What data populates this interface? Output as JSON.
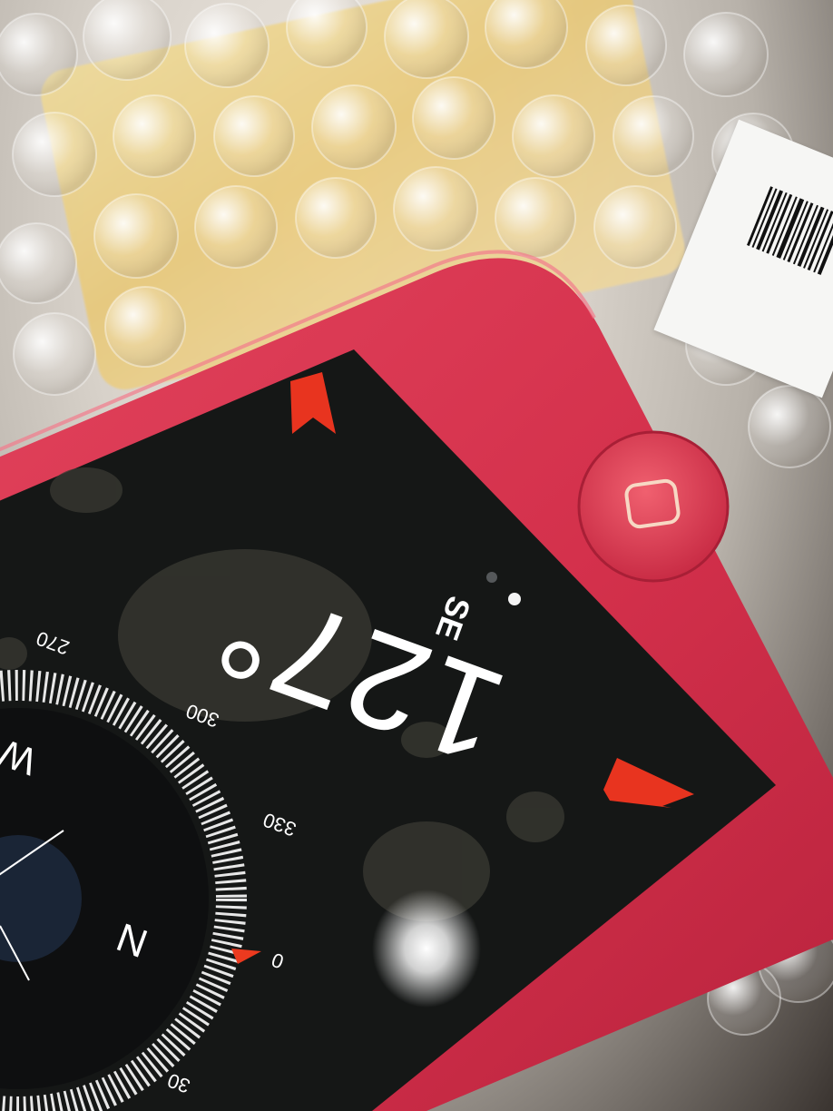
{
  "compass": {
    "heading": "127°",
    "direction": "SE",
    "ticks": [
      "270",
      "300",
      "330",
      "0",
      "30"
    ],
    "cardinals": {
      "west": "W",
      "north": "N"
    }
  },
  "device": {
    "body_color": "#d8334e",
    "home_button_icon": "home-button-square-icon"
  }
}
